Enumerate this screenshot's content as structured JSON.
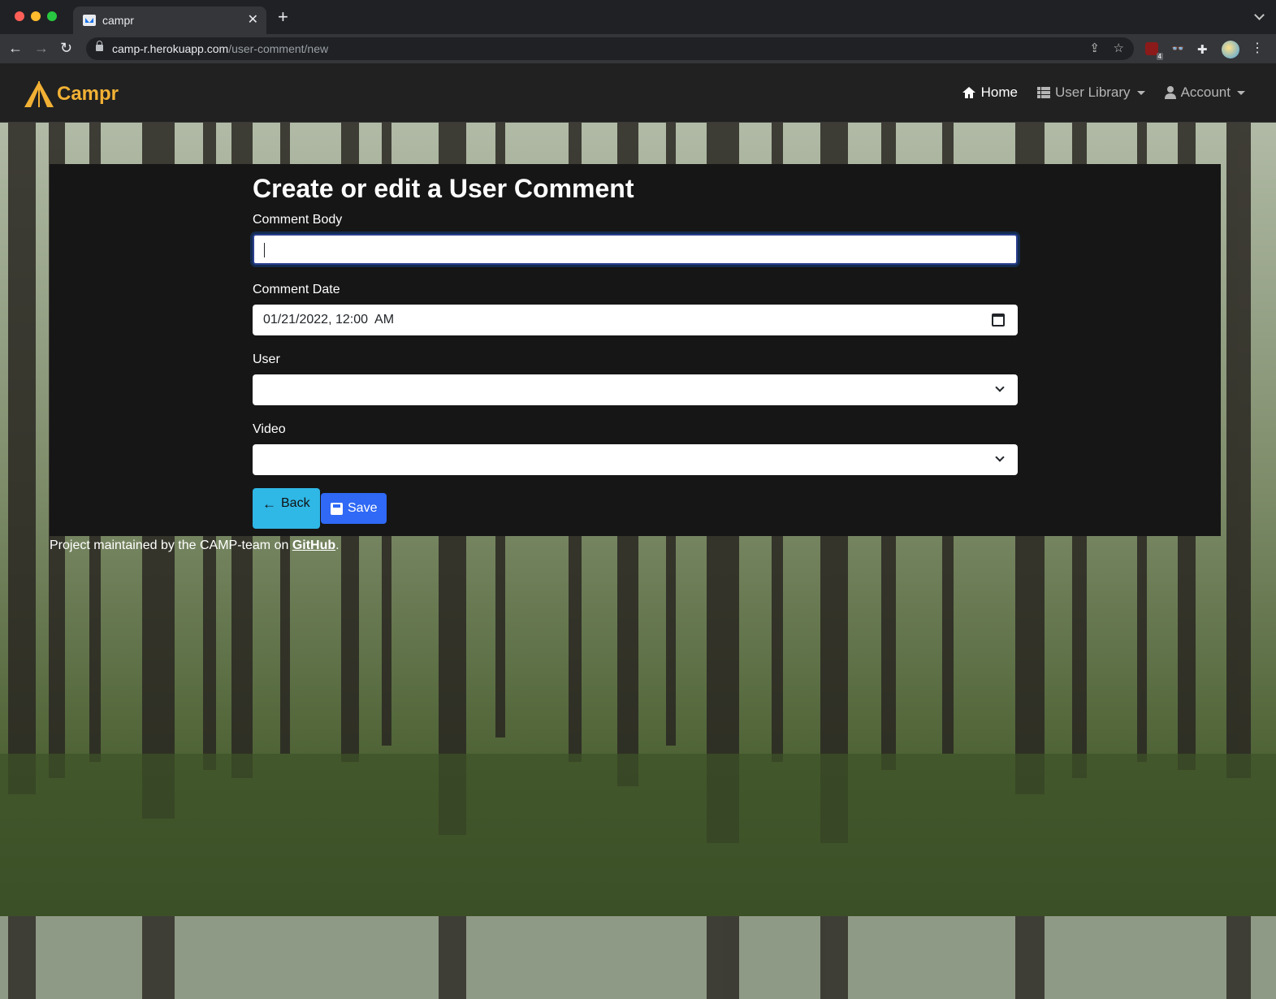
{
  "browser": {
    "tab_title": "campr",
    "url_host": "camp-r.herokuapp.com",
    "url_path": "/user-comment/new",
    "extension_badge": "4"
  },
  "navbar": {
    "brand": "Campr",
    "links": [
      {
        "label": "Home",
        "icon": "home-icon"
      },
      {
        "label": "User Library",
        "icon": "list-icon"
      },
      {
        "label": "Account",
        "icon": "user-icon"
      }
    ]
  },
  "form": {
    "title": "Create or edit a User Comment",
    "comment_body_label": "Comment Body",
    "comment_body_value": "",
    "comment_date_label": "Comment Date",
    "comment_date_value": "01/21/2022, 12:00  AM",
    "user_label": "User",
    "user_value": "",
    "video_label": "Video",
    "video_value": "",
    "back_label": "Back",
    "save_label": "Save"
  },
  "footer": {
    "text": "Project maintained by the CAMP-team on ",
    "link": "GitHub",
    "suffix": "."
  },
  "colors": {
    "brand": "#f2b134",
    "navbar_bg": "#212121",
    "card_bg": "#161616",
    "back_button": "#2fb7e6",
    "save_button": "#2f69f5"
  }
}
